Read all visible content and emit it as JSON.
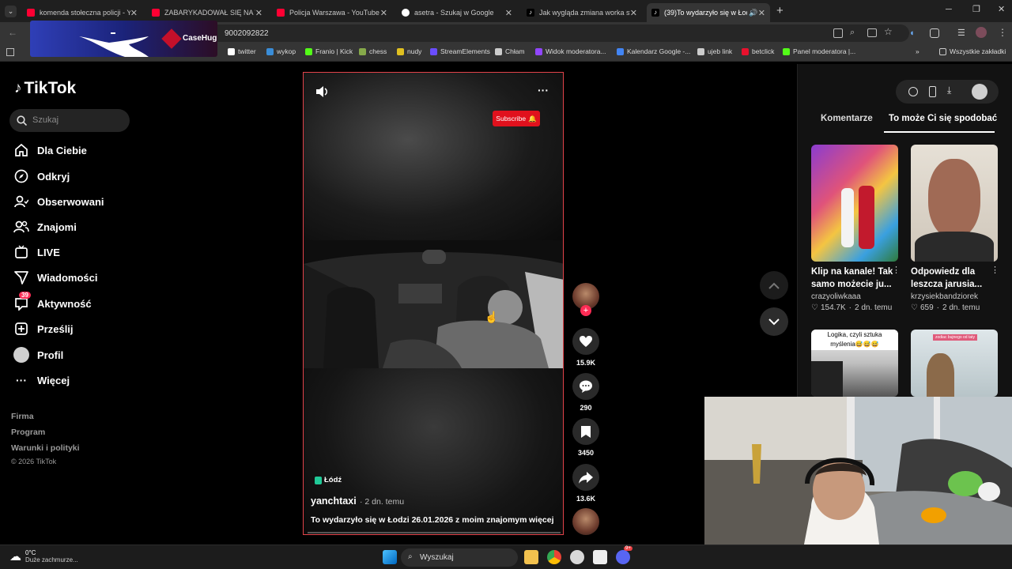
{
  "browser": {
    "tabs": [
      {
        "title": "komenda stołeczna policji - You",
        "favicon": "youtube"
      },
      {
        "title": "ZABARYKADOWAŁ SIĘ NA WA",
        "favicon": "youtube"
      },
      {
        "title": "Policja Warszawa - YouTube",
        "favicon": "youtube"
      },
      {
        "title": "asetra - Szukaj w Google",
        "favicon": "google"
      },
      {
        "title": "Jak wygląda zmiana worka stom",
        "favicon": "tiktok"
      },
      {
        "title": "(39)To wydarzyło się w Łodz",
        "favicon": "tiktok",
        "active": true
      }
    ],
    "url": "9002092822",
    "bookmarks": [
      {
        "label": "twitter",
        "color": "#ffffff"
      },
      {
        "label": "wykop",
        "color": "#3a8dd8"
      },
      {
        "label": "Franio | Kick",
        "color": "#53fc18"
      },
      {
        "label": "chess",
        "color": "#86a94a"
      },
      {
        "label": "nudy",
        "color": "#e0c020"
      },
      {
        "label": "StreamElements",
        "color": "#6a4dff"
      },
      {
        "label": "Chłam",
        "color": "#cccccc"
      },
      {
        "label": "Widok moderatora...",
        "color": "#9146ff"
      },
      {
        "label": "Kalendarz Google -...",
        "color": "#4285f4"
      },
      {
        "label": "ujeb link",
        "color": "#cccccc"
      },
      {
        "label": "betclick",
        "color": "#e8112d"
      },
      {
        "label": "Panel moderatora |...",
        "color": "#53fc18"
      }
    ],
    "all_bookmarks": "Wszystkie zakładki"
  },
  "overlay": {
    "brand": "CaseHug"
  },
  "tiktok": {
    "logo": "TikTok",
    "search_placeholder": "Szukaj",
    "nav": [
      {
        "label": "Dla Ciebie",
        "icon": "home-icon"
      },
      {
        "label": "Odkryj",
        "icon": "compass-icon"
      },
      {
        "label": "Obserwowani",
        "icon": "following-icon"
      },
      {
        "label": "Znajomi",
        "icon": "friends-icon"
      },
      {
        "label": "LIVE",
        "icon": "live-icon"
      },
      {
        "label": "Wiadomości",
        "icon": "messages-icon"
      },
      {
        "label": "Aktywność",
        "icon": "activity-icon",
        "badge": "39"
      },
      {
        "label": "Prześlij",
        "icon": "upload-icon"
      },
      {
        "label": "Profil",
        "icon": "profile-icon"
      },
      {
        "label": "Więcej",
        "icon": "more-icon"
      }
    ],
    "footer": [
      "Firma",
      "Program",
      "Warunki i polityki",
      "© 2026 TikTok"
    ],
    "video": {
      "subscribe": "Subscribe",
      "location": "Łódź",
      "author": "yanchtaxi",
      "posted": "· 2 dn. temu",
      "caption": "To wydarzyło się w Łodzi 26.01.2026 z moim znajomym",
      "more": "więcej"
    },
    "actions": {
      "likes": "15.9K",
      "comments": "290",
      "saves": "3450",
      "shares": "13.6K"
    },
    "right_tabs": [
      "Komentarze",
      "To może Ci się spodobać"
    ],
    "suggestions": [
      {
        "title": "Klip na kanale! Tak samo możecie ju...",
        "author": "crazyoliwkaaa",
        "likes": "154.7K",
        "ago": "2 dn. temu"
      },
      {
        "title": "Odpowiedz dla leszcza jarusia...",
        "author": "krzysiekbandziorek",
        "likes": "659",
        "ago": "2 dn. temu"
      }
    ],
    "suggestion_captions": [
      "Logika, czyli sztuka myślenia😅😅😅",
      "zodiac bujnego od taty"
    ]
  },
  "taskbar": {
    "temp": "0°C",
    "weather": "Duże zachmurze...",
    "search": "Wyszukaj",
    "discord_badge": "9+"
  }
}
